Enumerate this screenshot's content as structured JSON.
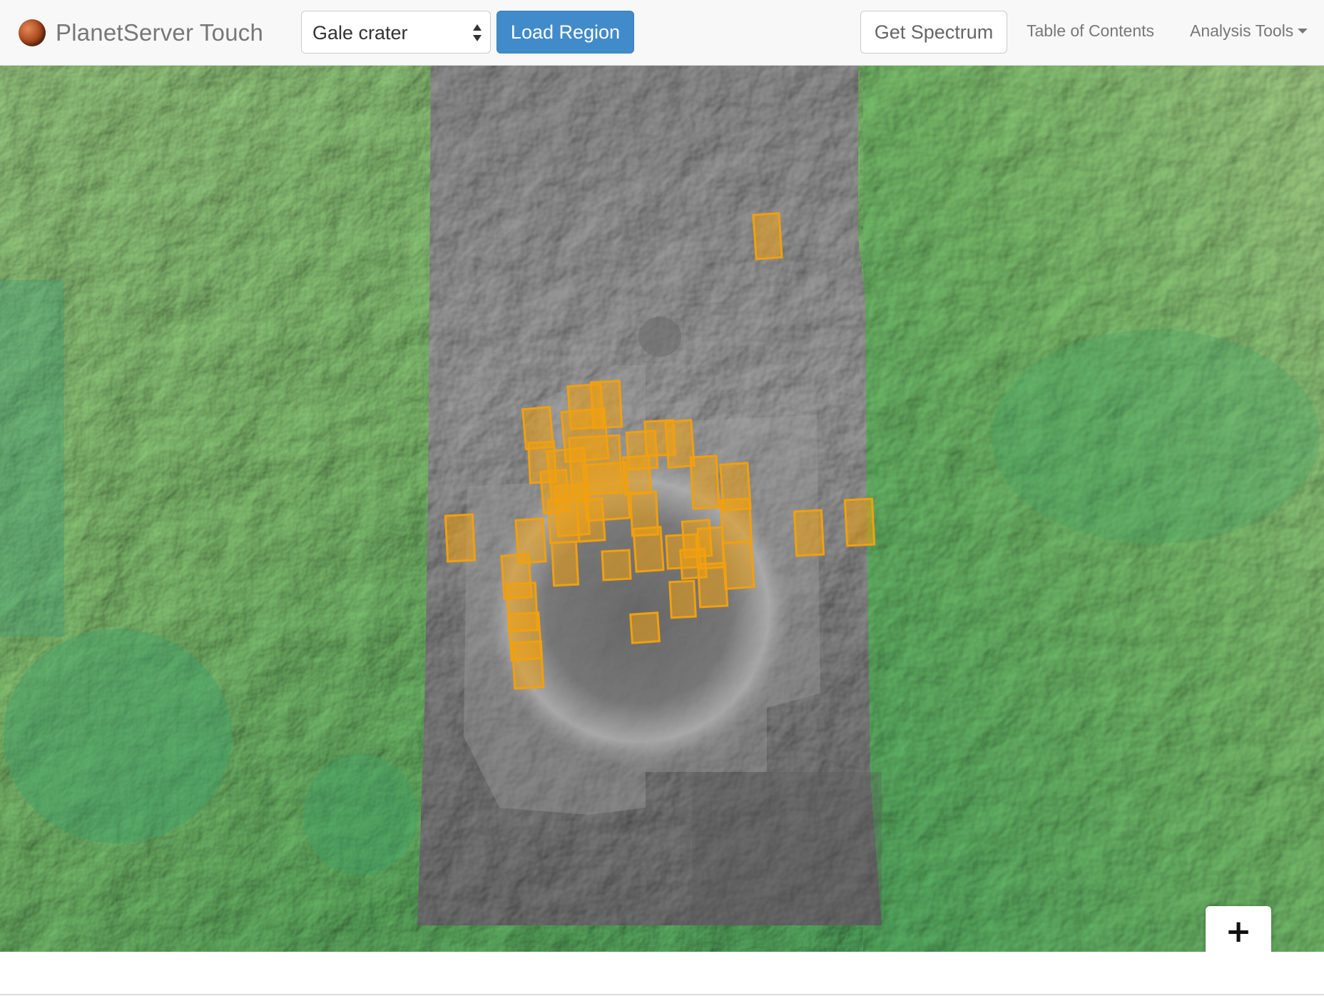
{
  "navbar": {
    "brand": "PlanetServer Touch",
    "brand_icon": "mars-planet-icon",
    "region_select": {
      "value": "Gale crater",
      "options": [
        "Gale crater"
      ]
    },
    "load_button": "Load Region",
    "spectrum_button": "Get Spectrum",
    "toc_link": "Table of Contents",
    "tools_menu": "Analysis Tools"
  },
  "map": {
    "base_layer": "colorized-elevation-green",
    "overlay": "grayscale-mosaic",
    "footprint_color": "#f0a010",
    "zoom_in": "+",
    "zoom_out": "−"
  },
  "colors": {
    "primary": "#428bca",
    "navbar_bg": "#f8f8f8",
    "brand_text": "#777777"
  }
}
